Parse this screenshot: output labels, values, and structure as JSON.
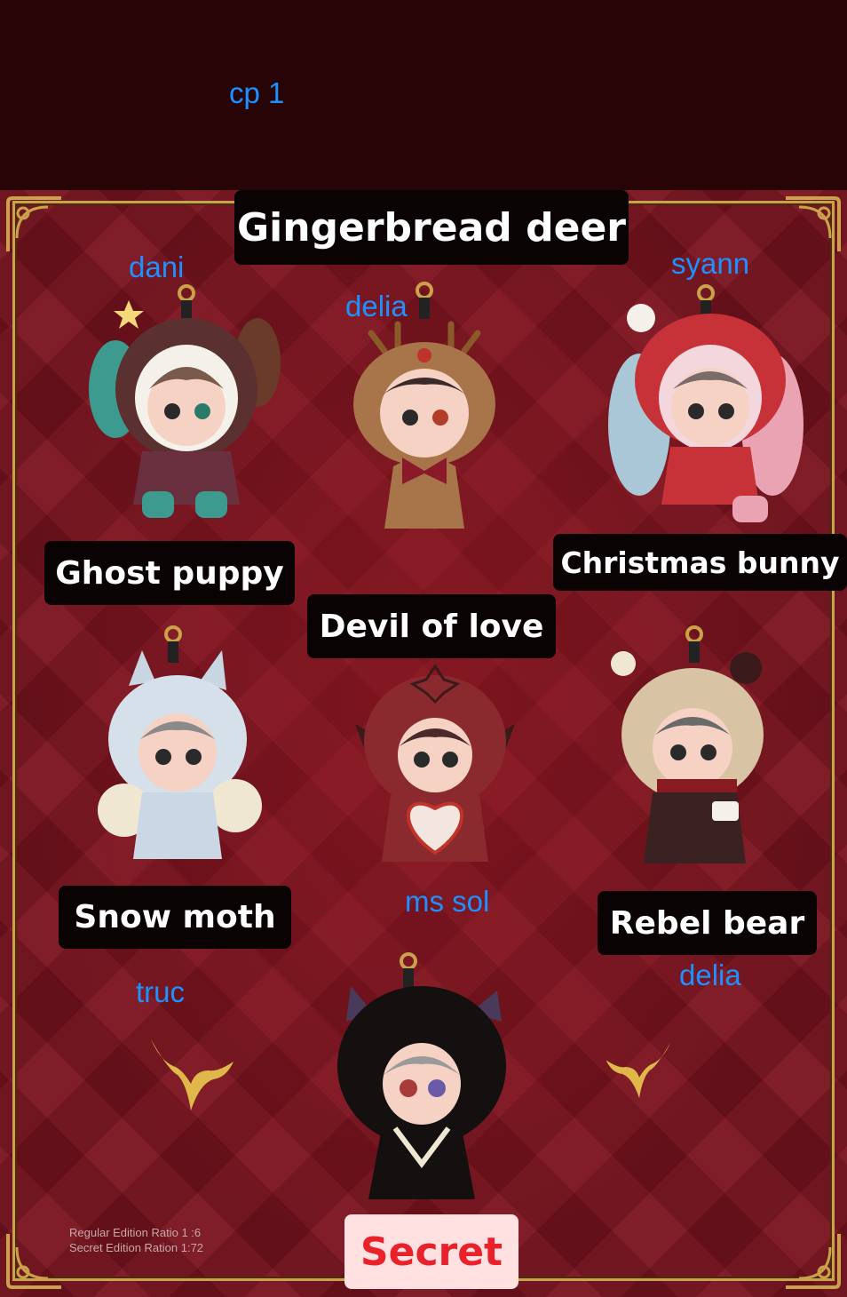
{
  "header_note": "cp 1",
  "labels": {
    "gingerbread_deer": "Gingerbread deer",
    "ghost_puppy": "Ghost puppy",
    "christmas_bunny": "Christmas bunny",
    "devil_of_love": "Devil of love",
    "snow_moth": "Snow moth",
    "rebel_bear": "Rebel bear",
    "secret": "Secret"
  },
  "claims": {
    "ghost_puppy": "dani",
    "gingerbread_deer": "delia",
    "christmas_bunny": "syann",
    "secret": "ms sol",
    "snow_moth": "truc",
    "rebel_bear": "delia"
  },
  "ratio": {
    "regular": "Regular Edition Ratio 1 :6",
    "secret": "Secret Edition Ration 1:72"
  },
  "colors": {
    "background": "#7a1420",
    "label_bg": "#0a0304",
    "note_text": "#1e90ff",
    "secret_bg": "#ffe1e1",
    "secret_text": "#e8212a",
    "gold": "#c9a24a"
  }
}
